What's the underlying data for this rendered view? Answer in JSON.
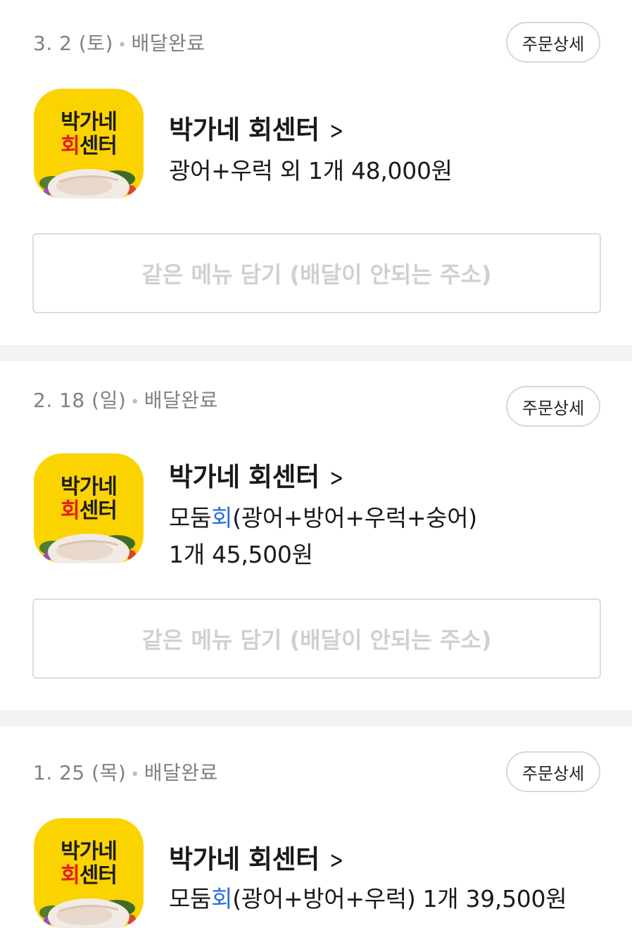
{
  "shared": {
    "detail_label": "주문상세",
    "reorder_label": "같은 메뉴 담기 (배달이 안되는 주소)",
    "logo_line1": "박가네",
    "logo_line2_red": "회",
    "logo_line2_rest": "센터",
    "colors": {
      "highlight": "#2a6fdb",
      "logo_bg": "#fbd300",
      "logo_red": "#e0201c"
    }
  },
  "orders": [
    {
      "date": "3. 2 (토)",
      "status": "배달완료",
      "store": "박가네 회센터",
      "menu_line1": "광어+우럭 외 1개 48,000원"
    },
    {
      "date": "2. 18 (일)",
      "status": "배달완료",
      "store": "박가네 회센터",
      "menu_prefix": "모둠",
      "menu_highlight": "회",
      "menu_suffix": "(광어+방어+우럭+숭어)",
      "menu_line2": "1개 45,500원"
    },
    {
      "date": "1. 25 (목)",
      "status": "배달완료",
      "store": "박가네 회센터",
      "menu_prefix": "모둠",
      "menu_highlight": "회",
      "menu_suffix": "(광어+방어+우럭) 1개 39,500원"
    }
  ]
}
